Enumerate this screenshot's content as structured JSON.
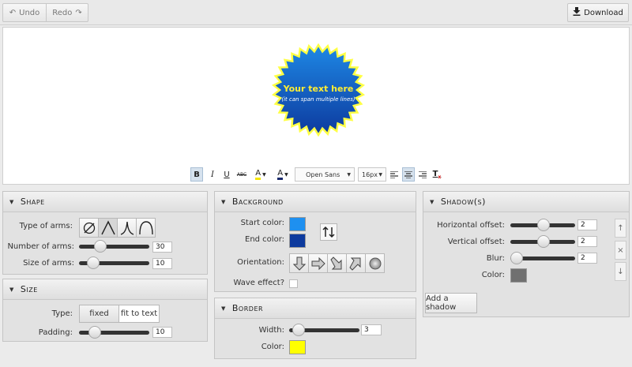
{
  "toolbar": {
    "undo_label": "Undo",
    "redo_label": "Redo",
    "download_label": "Download"
  },
  "canvas": {
    "badge_text": "Your text here",
    "badge_subtext": "(it can span multiple lines)",
    "badge_fill_start": "#1e88e5",
    "badge_fill_end": "#0d3a9e",
    "badge_border": "#ffff44"
  },
  "text_toolbar": {
    "bold": "B",
    "italic": "I",
    "underline": "U",
    "strikethrough": "ABC",
    "font_color_letter": "A",
    "bg_color_letter": "A",
    "font_family": "Open Sans",
    "font_size": "16px"
  },
  "shape": {
    "title": "Shape",
    "type_label": "Type of arms:",
    "number_label": "Number of arms:",
    "number_value": "30",
    "size_label": "Size of arms:",
    "size_value": "10"
  },
  "size": {
    "title": "Size",
    "type_label": "Type:",
    "type_options": [
      "fixed",
      "fit to text"
    ],
    "padding_label": "Padding:",
    "padding_value": "10"
  },
  "background": {
    "title": "Background",
    "start_label": "Start color:",
    "start_color": "#1e90f0",
    "end_label": "End color:",
    "end_color": "#0d3a9e",
    "orientation_label": "Orientation:",
    "wave_label": "Wave effect?"
  },
  "border": {
    "title": "Border",
    "width_label": "Width:",
    "width_value": "3",
    "color_label": "Color:",
    "color": "#ffff00"
  },
  "shadow": {
    "title": "Shadow(s)",
    "h_label": "Horizontal offset:",
    "h_value": "2",
    "v_label": "Vertical offset:",
    "v_value": "2",
    "blur_label": "Blur:",
    "blur_value": "2",
    "color_label": "Color:",
    "color": "#707070",
    "add_label": "Add a shadow",
    "up": "↑",
    "remove": "×",
    "down": "↓"
  }
}
